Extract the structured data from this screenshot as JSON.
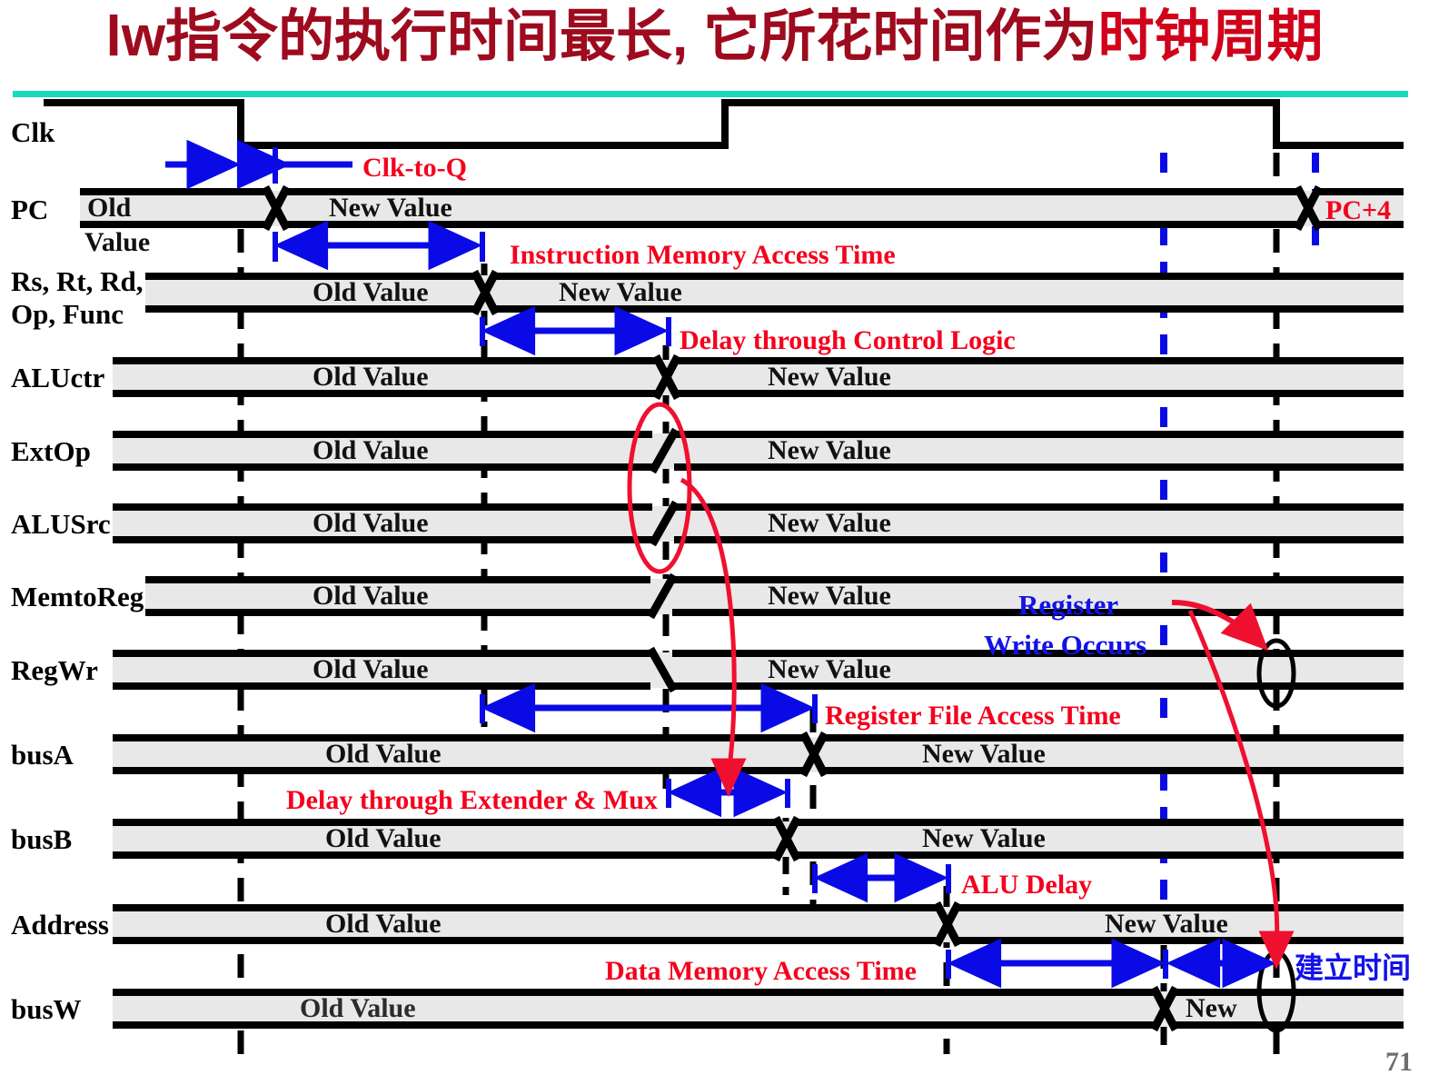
{
  "slide": {
    "title_prefix": "lw",
    "title": "lw指令的执行时间最长, 它所花时间作为时钟周期",
    "title_main": "指令的执行时间最长, 它所花时间作为",
    "title_accent": "时钟周期",
    "page_number": "71",
    "accent_color": "#9e0b1e",
    "rule_color": "#17d9bb",
    "red": "#f5001d",
    "blue": "#1212e8",
    "waveform_fill": "#e8e8e8"
  },
  "signals": [
    {
      "name": "Clk",
      "label": "Clk",
      "old": "",
      "new": ""
    },
    {
      "name": "PC",
      "label": "PC",
      "old": "Old",
      "old2": "Value",
      "new": "New Value",
      "tail": "PC+4"
    },
    {
      "name": "instr-fields",
      "label": "Rs, Rt, Rd,",
      "label2": "Op, Func",
      "old": "Old Value",
      "new": "New Value"
    },
    {
      "name": "ALUctr",
      "label": "ALUctr",
      "old": "Old Value",
      "new": "New Value"
    },
    {
      "name": "ExtOp",
      "label": "ExtOp",
      "old": "Old Value",
      "new": "New Value"
    },
    {
      "name": "ALUSrc",
      "label": "ALUSrc",
      "old": "Old Value",
      "new": "New Value"
    },
    {
      "name": "MemtoReg",
      "label": "MemtoReg",
      "old": "Old Value",
      "new": "New Value"
    },
    {
      "name": "RegWr",
      "label": "RegWr",
      "old": "Old Value",
      "new": "New Value"
    },
    {
      "name": "busA",
      "label": "busA",
      "old": "Old Value",
      "new": "New Value"
    },
    {
      "name": "busB",
      "label": "busB",
      "old": "Old Value",
      "new": "New Value"
    },
    {
      "name": "Address",
      "label": "Address",
      "old": "Old Value",
      "new": "New Value"
    },
    {
      "name": "busW",
      "label": "busW",
      "old": "Old Value",
      "new": "New"
    }
  ],
  "annotations": {
    "clk_to_q": "Clk-to-Q",
    "instr_mem": "Instruction Memory Access Time",
    "ctrl_logic": "Delay through Control Logic",
    "reg_file": "Register File Access Time",
    "ext_mux": "Delay through Extender & Mux",
    "alu_delay": "ALU Delay",
    "data_mem": "Data Memory Access Time",
    "reg_write_line1": "Register",
    "reg_write_line2": "Write Occurs",
    "setup_time": "建立时间",
    "pc_plus_4": "PC+4"
  }
}
